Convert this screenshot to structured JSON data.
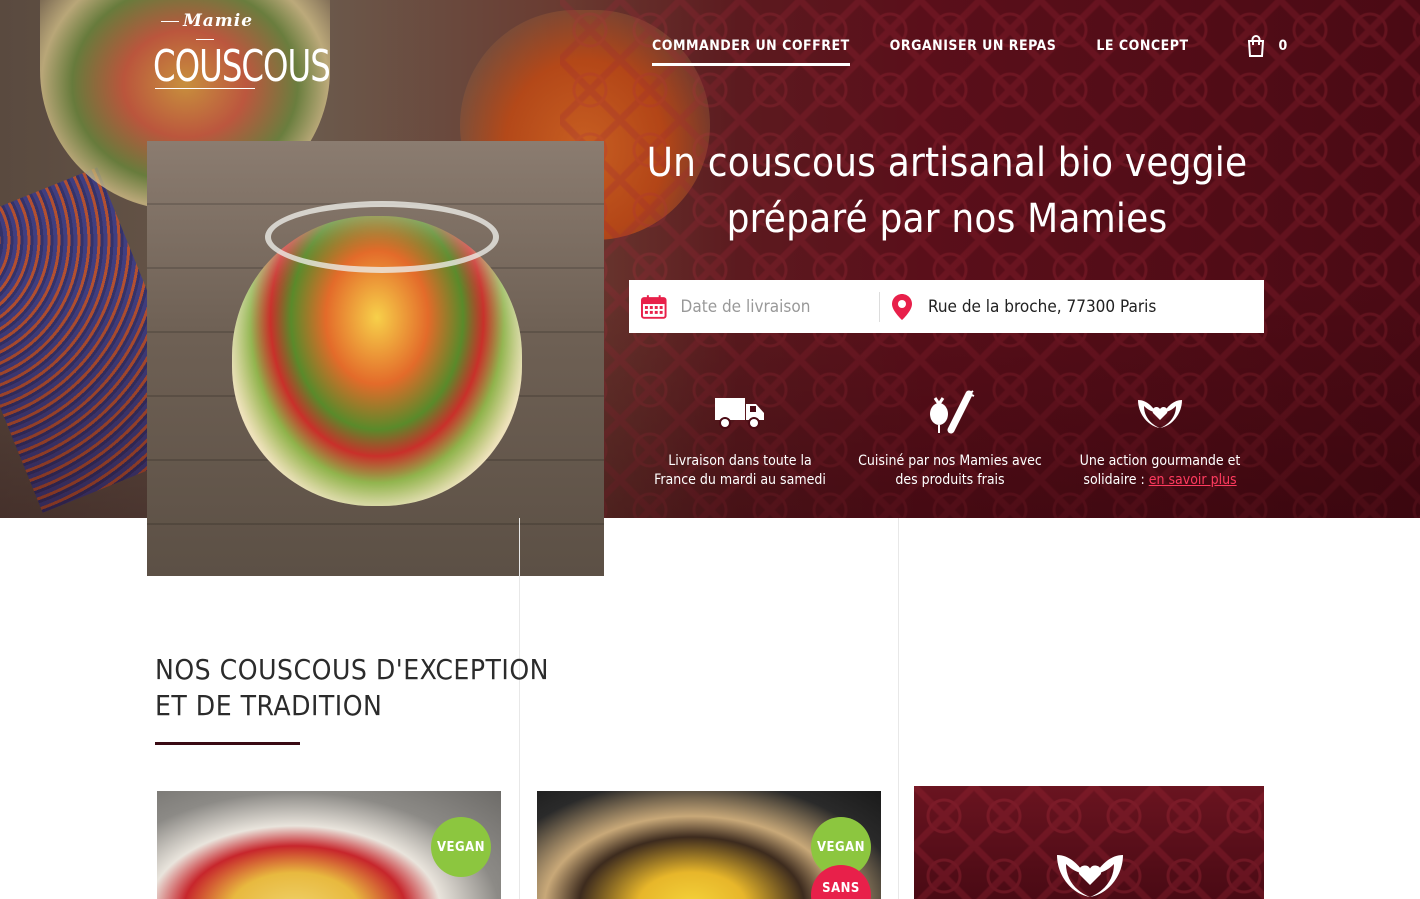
{
  "brand": {
    "logo_small": "Mamie",
    "logo_big": "COUSCOUS"
  },
  "nav": {
    "items": [
      {
        "label": "COMMANDER UN COFFRET"
      },
      {
        "label": "ORGANISER UN REPAS"
      },
      {
        "label": "LE CONCEPT"
      }
    ],
    "cart_count": "0"
  },
  "hero": {
    "tagline_line1": "Un couscous artisanal bio veggie",
    "tagline_line2": "préparé par nos Mamies"
  },
  "search": {
    "date_placeholder": "Date de livraison",
    "address_value": "Rue de la broche, 77300 Paris"
  },
  "features": [
    {
      "icon": "truck-icon",
      "line1": "Livraison dans toute la",
      "line2": "France du mardi au samedi"
    },
    {
      "icon": "vegetables-icon",
      "line1": "Cuisiné par nos Mamies avec",
      "line2": "des produits frais"
    },
    {
      "icon": "hands-heart-icon",
      "line1": "Une action gourmande et",
      "line2_prefix": "solidaire : ",
      "link": "en savoir plus"
    }
  ],
  "section": {
    "title_line1": "NOS COUSCOUS D'EXCEPTION",
    "title_line2": "ET DE TRADITION"
  },
  "cards": [
    {
      "badge1": "VEGAN"
    },
    {
      "badge1": "VEGAN",
      "badge2": "SANS"
    }
  ],
  "colors": {
    "brand_dark": "#4a0a14",
    "accent_red": "#e8204a",
    "vegan_green": "#8cc63f"
  }
}
